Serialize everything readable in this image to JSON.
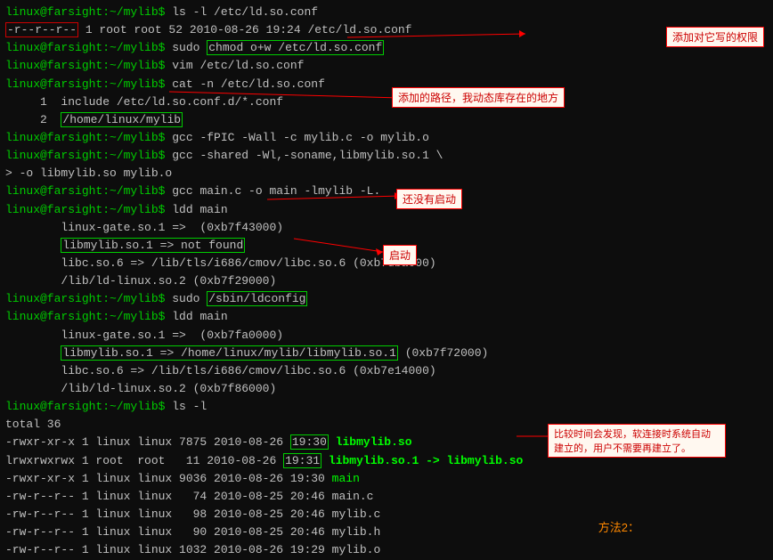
{
  "terminal": {
    "title": "linux@farsight:~/mylib$ terminal",
    "lines": [
      {
        "id": "l1",
        "text": "linux@farsight:~/mylib$ ls -l /etc/ld.so.conf"
      },
      {
        "id": "l2",
        "text": "-r--r--r-- 1 root root 52 2010-08-26 19:24 /etc/ld.so.conf"
      },
      {
        "id": "l3",
        "text": "linux@farsight:~/mylib$ sudo ",
        "cmd": "chmod o+w /etc/ld.so.conf",
        "annotation": "添加对它写的权限"
      },
      {
        "id": "l4",
        "text": "linux@farsight:~/mylib$ vim /etc/ld.so.conf"
      },
      {
        "id": "l5",
        "text": "linux@farsight:~/mylib$ cat -n /etc/ld.so.conf"
      },
      {
        "id": "l6",
        "text": "     1  include /etc/ld.so.conf.d/*.conf"
      },
      {
        "id": "l7",
        "text": "     2  /home/linux/mylib",
        "annotation": "添加的路径，我动态库存在的地方"
      },
      {
        "id": "l8",
        "text": "linux@farsight:~/mylib$ gcc -fPIC -Wall -c mylib.c -o mylib.o"
      },
      {
        "id": "l9",
        "text": "linux@farsight:~/mylib$ gcc -shared -Wl,-soname,libmylib.so.1 \\"
      },
      {
        "id": "l10",
        "text": "> -o libmylib.so mylib.o"
      },
      {
        "id": "l11",
        "text": "linux@farsight:~/mylib$ gcc main.c -o main -lmylib -L."
      },
      {
        "id": "l12",
        "text": "linux@farsight:~/mylib$ ldd main"
      },
      {
        "id": "l13",
        "text": "\tlinux-gate.so.1 =>  (0xb7f43000)"
      },
      {
        "id": "l14",
        "text": "\t",
        "highlighted": "libmylib.so.1 => not found",
        "annotation": "还没有启动"
      },
      {
        "id": "l15",
        "text": "\tlibc.so.6 => /lib/tls/i686/cmov/libc.so.6 (0xb7dba000)"
      },
      {
        "id": "l16",
        "text": "\t/lib/ld-linux.so.2 (0xb7f29000)"
      },
      {
        "id": "l17",
        "text": "linux@farsight:~/mylib$ sudo ",
        "cmd": "/sbin/ldconfig",
        "annotation": "启动"
      },
      {
        "id": "l18",
        "text": "linux@farsight:~/mylib$ ldd main"
      },
      {
        "id": "l19",
        "text": "\tlinux-gate.so.1 =>  (0xb7fa0000)"
      },
      {
        "id": "l20",
        "text": "\t",
        "highlighted2": "libmylib.so.1 => /home/linux/mylib/libmylib.so.1",
        "rest": " (0xb7f72000)"
      },
      {
        "id": "l21",
        "text": "\tlibc.so.6 => /lib/tls/i686/cmov/libc.so.6 (0xb7e14000)"
      },
      {
        "id": "l22",
        "text": "\t/lib/ld-linux.so.2 (0xb7f86000)"
      },
      {
        "id": "l23",
        "text": "linux@farsight:~/mylib$ ls -l"
      },
      {
        "id": "l24",
        "text": "total 36"
      },
      {
        "id": "l25",
        "text": "-rwxr-xr-x 1 linux linux 7875 2010-08-26 ",
        "ts": "19:30",
        "file": " libmylib.so"
      },
      {
        "id": "l26",
        "text": "lrwxrwxrwx 1 root  root   11 2010-08-26 ",
        "ts": "19:31",
        "file": " libmylib.so.1 -> libmylib.so"
      },
      {
        "id": "l27",
        "text": "-rwxr-xr-x 1 linux linux 9036 2010-08-26 19:30 ",
        "file2": "main"
      },
      {
        "id": "l28",
        "text": "-rw-r--r-- 1 linux linux   74 2010-08-25 20:46 main.c"
      },
      {
        "id": "l29",
        "text": "-rw-r--r-- 1 linux linux   98 2010-08-25 20:46 mylib.c"
      },
      {
        "id": "l30",
        "text": "-rw-r--r-- 1 linux linux   90 2010-08-25 20:46 mylib.h"
      },
      {
        "id": "l31",
        "text": "-rw-r--r-- 1 linux linux 1032 2010-08-26 19:29 mylib.o"
      }
    ],
    "annotations": {
      "chmod": "添加对它写的权限",
      "path": "添加的路径，我动态库存在的地方",
      "not_started": "还没有启动",
      "ldconfig": "启动",
      "auto_link": "比较时间会发现，软连接时系统自\n动建立的，用户不需要再建立了。",
      "method2": "方法2："
    }
  }
}
